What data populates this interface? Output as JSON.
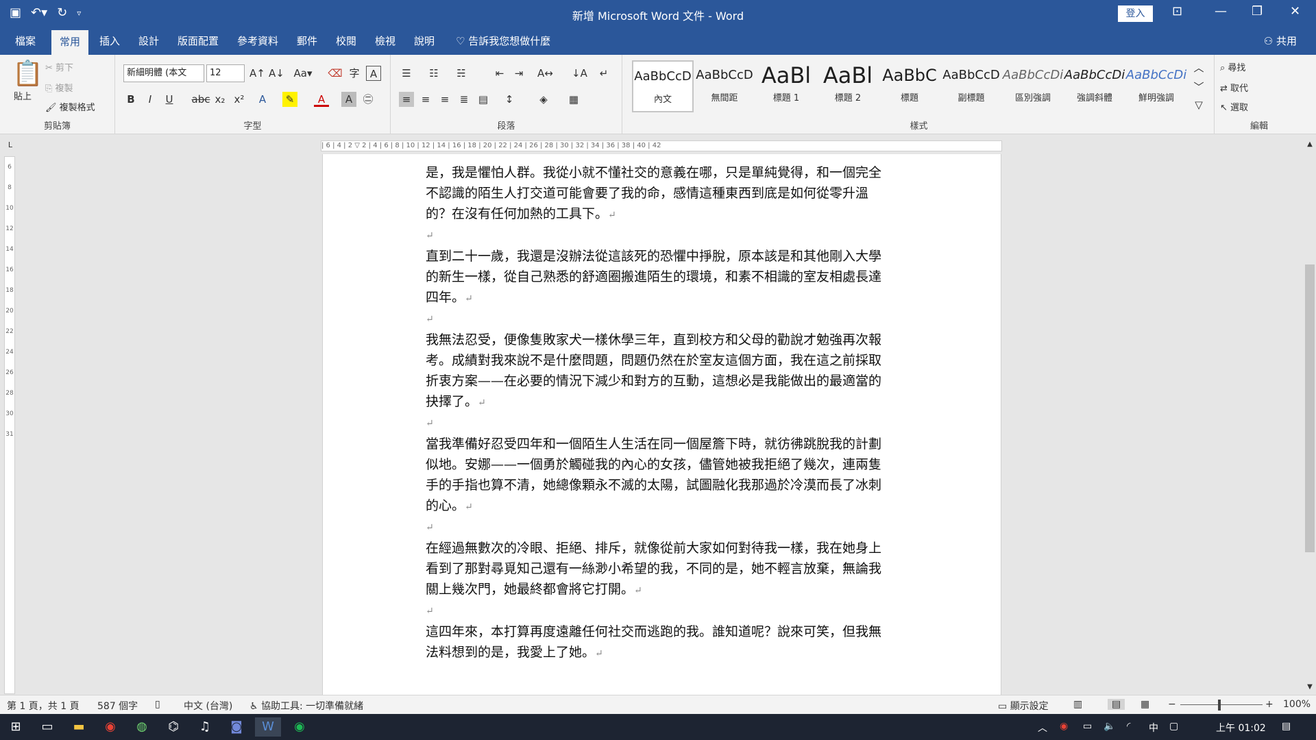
{
  "window": {
    "title": "新增 Microsoft Word 文件 - Word",
    "login": "登入",
    "share": "共用"
  },
  "tabs": [
    "檔案",
    "常用",
    "插入",
    "設計",
    "版面配置",
    "參考資料",
    "郵件",
    "校閱",
    "檢視",
    "說明"
  ],
  "tell_me": "告訴我您想做什麼",
  "clipboard": {
    "paste": "貼上",
    "cut": "剪下",
    "copy": "複製",
    "format_painter": "複製格式",
    "label": "剪貼簿"
  },
  "font": {
    "name": "新細明體 (本文",
    "size": "12",
    "label": "字型"
  },
  "paragraph": {
    "label": "段落"
  },
  "styles": {
    "items": [
      {
        "preview": "AaBbCcD",
        "name": "內文"
      },
      {
        "preview": "AaBbCcD",
        "name": "無間距"
      },
      {
        "preview": "AaBl",
        "name": "標題 1"
      },
      {
        "preview": "AaBl",
        "name": "標題 2"
      },
      {
        "preview": "AaBbC",
        "name": "標題"
      },
      {
        "preview": "AaBbCcD",
        "name": "副標題"
      },
      {
        "preview": "AaBbCcDi",
        "name": "區別強調"
      },
      {
        "preview": "AaBbCcDi",
        "name": "強調斜體"
      },
      {
        "preview": "AaBbCcDi",
        "name": "鮮明強調"
      }
    ],
    "label": "樣式"
  },
  "editing": {
    "find": "尋找",
    "replace": "取代",
    "select": "選取",
    "label": "編輯"
  },
  "document": {
    "paragraphs": [
      "是，我是懼怕人群。我從小就不懂社交的意義在哪，只是單純覺得，和一個完全不認識的陌生人打交道可能會要了我的命，感情這種東西到底是如何從零升溫的？在沒有任何加熱的工具下。",
      "直到二十一歲，我還是沒辦法從這該死的恐懼中掙脫，原本該是和其他剛入大學的新生一樣，從自己熟悉的舒適圈搬進陌生的環境，和素不相識的室友相處長達四年。",
      "我無法忍受，便像隻敗家犬一樣休學三年，直到校方和父母的勸說才勉強再次報考。成績對我來說不是什麼問題，問題仍然在於室友這個方面，我在這之前採取折衷方案——在必要的情況下減少和對方的互動，這想必是我能做出的最適當的抉擇了。",
      "當我準備好忍受四年和一個陌生人生活在同一個屋簷下時，就彷彿跳脫我的計劃似地。安娜——一個勇於觸碰我的內心的女孩，儘管她被我拒絕了幾次，連兩隻手的手指也算不清，她總像顆永不滅的太陽，試圖融化我那過於冷漠而長了冰刺的心。",
      "在經過無數次的冷眼、拒絕、排斥，就像從前大家如何對待我一樣，我在她身上看到了那對尋覓知己還有一絲渺小希望的我，不同的是，她不輕言放棄，無論我關上幾次門，她最終都會將它打開。",
      "這四年來，本打算再度遠離任何社交而逃跑的我。誰知道呢？說來可笑，但我無法料想到的是，我愛上了她。"
    ],
    "mark": "↵"
  },
  "status": {
    "page": "第 1 頁，共 1 頁",
    "words": "587 個字",
    "language": "中文 (台灣)",
    "accessibility": "協助工具: 一切準備就緒",
    "display": "顯示設定",
    "zoom": "100%"
  },
  "tray": {
    "ime": "中",
    "clock": "上午 01:02"
  }
}
